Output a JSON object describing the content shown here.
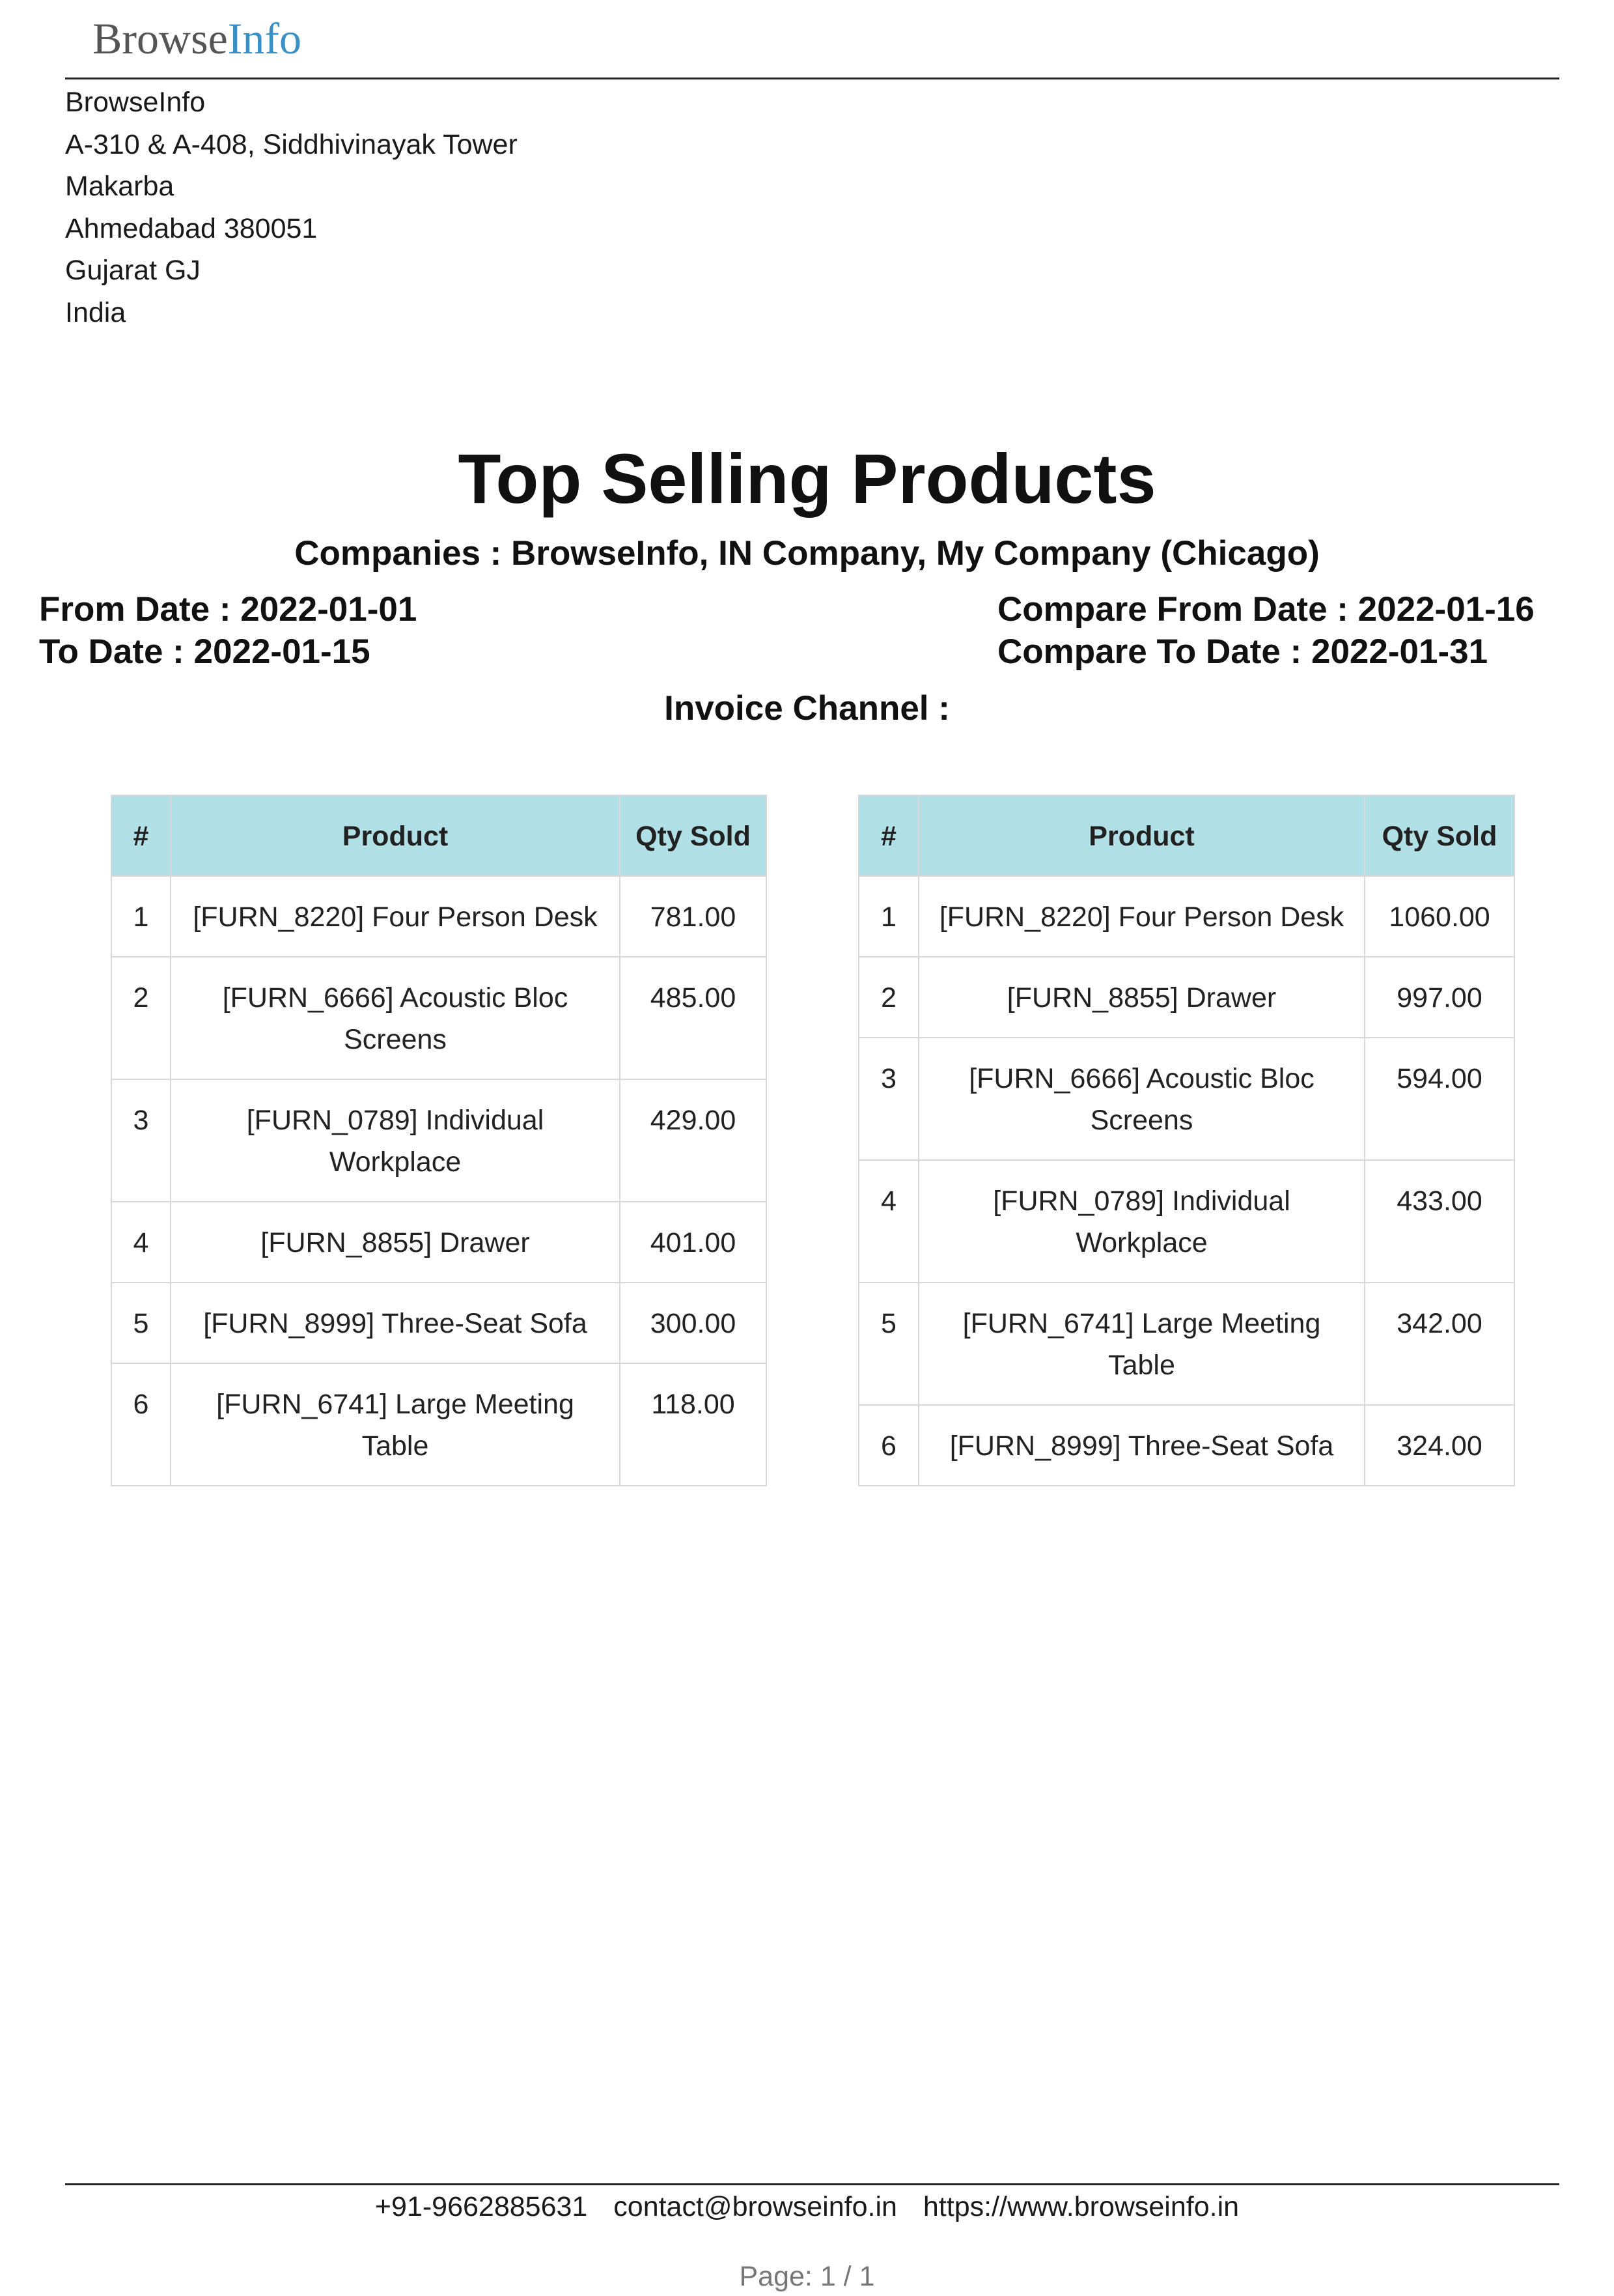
{
  "logo": {
    "part1": "Browse",
    "part2": "Info"
  },
  "address": [
    "BrowseInfo",
    "A-310 & A-408, Siddhivinayak Tower",
    "Makarba",
    "Ahmedabad 380051",
    "Gujarat GJ",
    "India"
  ],
  "report": {
    "title": "Top Selling Products",
    "companies": "Companies : BrowseInfo, IN Company, My Company (Chicago)",
    "from_date": "From Date : 2022-01-01",
    "to_date": "To Date : 2022-01-15",
    "compare_from_date": "Compare From Date : 2022-01-16",
    "compare_to_date": "Compare To Date : 2022-01-31",
    "invoice_channel": "Invoice Channel :"
  },
  "table_headers": {
    "index": "#",
    "product": "Product",
    "qty": "Qty Sold"
  },
  "left_table": [
    {
      "index": "1",
      "product": "[FURN_8220] Four Person Desk",
      "qty": "781.00"
    },
    {
      "index": "2",
      "product": "[FURN_6666] Acoustic Bloc Screens",
      "qty": "485.00"
    },
    {
      "index": "3",
      "product": "[FURN_0789] Individual Workplace",
      "qty": "429.00"
    },
    {
      "index": "4",
      "product": "[FURN_8855] Drawer",
      "qty": "401.00"
    },
    {
      "index": "5",
      "product": "[FURN_8999] Three-Seat Sofa",
      "qty": "300.00"
    },
    {
      "index": "6",
      "product": "[FURN_6741] Large Meeting Table",
      "qty": "118.00"
    }
  ],
  "right_table": [
    {
      "index": "1",
      "product": "[FURN_8220] Four Person Desk",
      "qty": "1060.00"
    },
    {
      "index": "2",
      "product": "[FURN_8855] Drawer",
      "qty": "997.00"
    },
    {
      "index": "3",
      "product": "[FURN_6666] Acoustic Bloc Screens",
      "qty": "594.00"
    },
    {
      "index": "4",
      "product": "[FURN_0789] Individual Workplace",
      "qty": "433.00"
    },
    {
      "index": "5",
      "product": "[FURN_6741] Large Meeting Table",
      "qty": "342.00"
    },
    {
      "index": "6",
      "product": "[FURN_8999] Three-Seat Sofa",
      "qty": "324.00"
    }
  ],
  "footer": {
    "phone": "+91-9662885631",
    "email": "contact@browseinfo.in",
    "website": "https://www.browseinfo.in",
    "page": "Page: 1 / 1"
  }
}
